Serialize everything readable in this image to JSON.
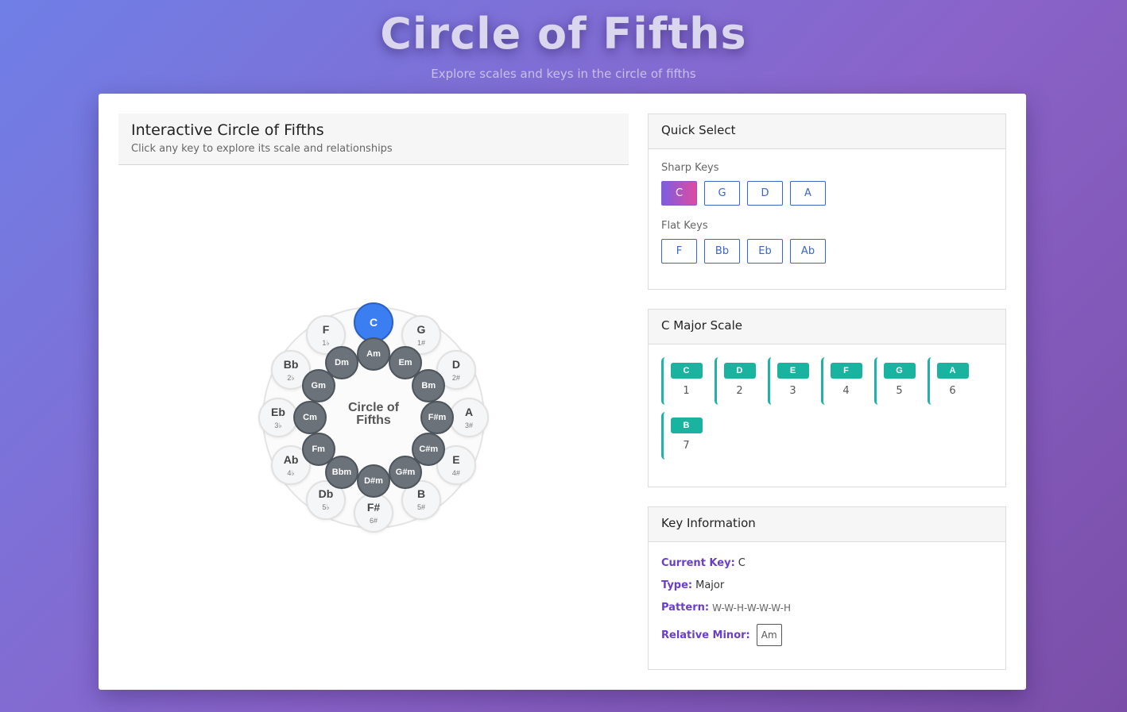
{
  "header": {
    "title": "Circle of Fifths",
    "subtitle": "Explore scales and keys in the circle of fifths"
  },
  "circle_panel": {
    "title": "Interactive Circle of Fifths",
    "subtitle": "Click any key to explore its scale and relationships",
    "center_line1": "Circle of",
    "center_line2": "Fifths",
    "major_keys": [
      {
        "name": "C",
        "acc": ""
      },
      {
        "name": "G",
        "acc": "1#"
      },
      {
        "name": "D",
        "acc": "2#"
      },
      {
        "name": "A",
        "acc": "3#"
      },
      {
        "name": "E",
        "acc": "4#"
      },
      {
        "name": "B",
        "acc": "5#"
      },
      {
        "name": "F#",
        "acc": "6#"
      },
      {
        "name": "Db",
        "acc": "5♭"
      },
      {
        "name": "Ab",
        "acc": "4♭"
      },
      {
        "name": "Eb",
        "acc": "3♭"
      },
      {
        "name": "Bb",
        "acc": "2♭"
      },
      {
        "name": "F",
        "acc": "1♭"
      }
    ],
    "minor_keys": [
      "Am",
      "Em",
      "Bm",
      "F#m",
      "C#m",
      "G#m",
      "D#m",
      "Bbm",
      "Fm",
      "Cm",
      "Gm",
      "Dm"
    ],
    "active_key": "C",
    "colors": {
      "active": "#3b7ef2",
      "minor": "#6b727a"
    }
  },
  "quick_select": {
    "title": "Quick Select",
    "sharp_label": "Sharp Keys",
    "sharp_keys": [
      "C",
      "G",
      "D",
      "A"
    ],
    "flat_label": "Flat Keys",
    "flat_keys": [
      "F",
      "Bb",
      "Eb",
      "Ab"
    ]
  },
  "scale": {
    "title": "C Major Scale",
    "notes": [
      {
        "note": "C",
        "degree": "1"
      },
      {
        "note": "D",
        "degree": "2"
      },
      {
        "note": "E",
        "degree": "3"
      },
      {
        "note": "F",
        "degree": "4"
      },
      {
        "note": "G",
        "degree": "5"
      },
      {
        "note": "A",
        "degree": "6"
      },
      {
        "note": "B",
        "degree": "7"
      }
    ]
  },
  "key_info": {
    "title": "Key Information",
    "current_key_label": "Current Key:",
    "current_key": "C",
    "type_label": "Type:",
    "type": "Major",
    "pattern_label": "Pattern:",
    "pattern": "W-W-H-W-W-W-H",
    "relative_minor_label": "Relative Minor:",
    "relative_minor": "Am"
  }
}
